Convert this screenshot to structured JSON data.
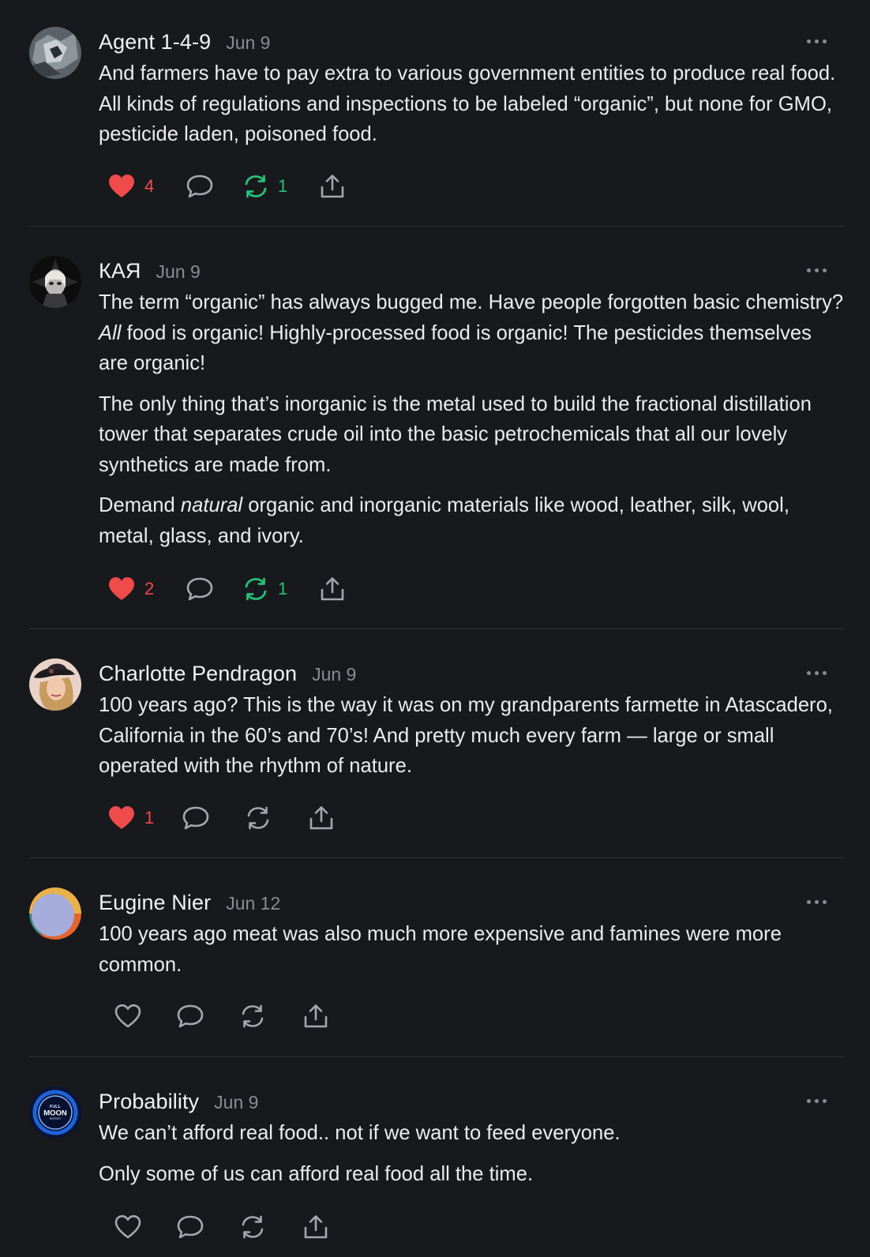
{
  "comments": [
    {
      "author": "Agent 1-4-9",
      "date": "Jun 9",
      "paragraphs": [
        "And farmers have to pay extra to various government entities to produce real food. All kinds of regulations and inspections to be labeled “organic”, but none for GMO, pesticide laden, poisoned food."
      ],
      "likes": "4",
      "restacks": "1",
      "liked": true,
      "restacked": true
    },
    {
      "author": "КАЯ",
      "date": "Jun 9",
      "paragraphs": [
        "The term “organic” has always bugged me. Have people forgotten basic chemistry?",
        "All",
        "food is organic! Highly-processed food is organic! The pesticides themselves are organic!",
        "The only thing that’s inorganic is the metal used to build the fractional distillation tower that separates crude oil into the basic petrochemicals that all our lovely synthetics are made from.",
        "Demand",
        "natural",
        "organic and inorganic materials like wood, leather, silk, wool, metal, glass, and ivory."
      ],
      "likes": "2",
      "restacks": "1",
      "liked": true,
      "restacked": true
    },
    {
      "author": "Charlotte Pendragon",
      "date": "Jun 9",
      "paragraphs": [
        "100 years ago? This is the way it was on my grandparents farmette in Atascadero, California in the 60’s and 70’s! And pretty much every farm — large or small operated with the rhythm of nature."
      ],
      "likes": "1",
      "restacks": "",
      "liked": true,
      "restacked": false
    },
    {
      "author": "Eugine Nier",
      "date": "Jun 12",
      "paragraphs": [
        "100 years ago meat was also much more expensive and famines were more common."
      ],
      "likes": "",
      "restacks": "",
      "liked": false,
      "restacked": false
    },
    {
      "author": "Probability",
      "date": "Jun 9",
      "paragraphs": [
        "We can’t afford real food.. not if we want to feed everyone.",
        "Only some of us can afford real food all the time."
      ],
      "likes": "",
      "restacks": "",
      "liked": false,
      "restacked": false
    }
  ],
  "avatar_logo_text": [
    "FULL",
    "MOON",
    "REPORT"
  ],
  "icons": {
    "like": "heart-icon",
    "reply": "comment-bubble-icon",
    "restack": "restack-icon",
    "share": "share-icon",
    "more": "more-options-icon"
  },
  "colors": {
    "background": "#18191c",
    "like": "#ef4b4b",
    "restack": "#27c079",
    "muted": "#8b8c92"
  }
}
